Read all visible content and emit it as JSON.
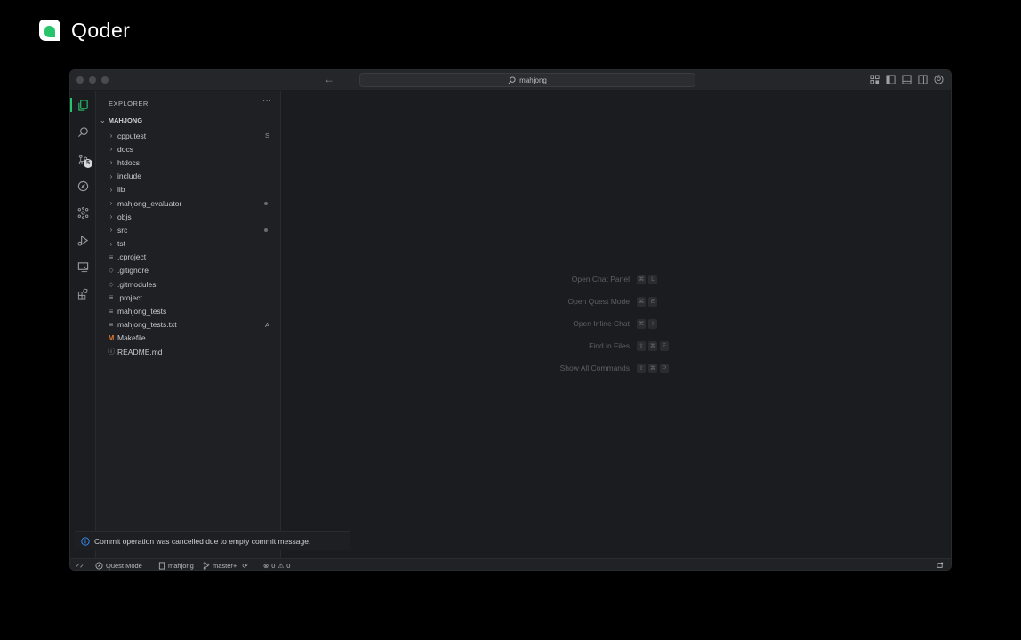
{
  "brand": {
    "name": "Qoder",
    "accent": "#27c46b"
  },
  "titlebar": {
    "search_text": "mahjong"
  },
  "activity_bar": {
    "items": [
      {
        "name": "explorer",
        "icon": "files-icon",
        "active": true
      },
      {
        "name": "search",
        "icon": "search-icon"
      },
      {
        "name": "source-control",
        "icon": "source-control-icon",
        "badge": "5"
      },
      {
        "name": "quest",
        "icon": "compass-icon"
      },
      {
        "name": "graph",
        "icon": "graph-icon"
      },
      {
        "name": "run-debug",
        "icon": "run-debug-icon"
      },
      {
        "name": "remote",
        "icon": "remote-explorer-icon"
      },
      {
        "name": "extensions",
        "icon": "extensions-icon"
      }
    ]
  },
  "sidebar": {
    "title": "EXPLORER",
    "more": "···",
    "root": "MAHJONG",
    "items": [
      {
        "label": "cpputest",
        "type": "folder",
        "status": "S"
      },
      {
        "label": "docs",
        "type": "folder"
      },
      {
        "label": "htdocs",
        "type": "folder"
      },
      {
        "label": "include",
        "type": "folder"
      },
      {
        "label": "lib",
        "type": "folder"
      },
      {
        "label": "mahjong_evaluator",
        "type": "folder",
        "dot": true
      },
      {
        "label": "objs",
        "type": "folder"
      },
      {
        "label": "src",
        "type": "folder",
        "dot": true
      },
      {
        "label": "tst",
        "type": "folder"
      },
      {
        "label": ".cproject",
        "type": "file",
        "icon": "lines-icon"
      },
      {
        "label": ".gitignore",
        "type": "file",
        "icon": "diamond-icon"
      },
      {
        "label": ".gitmodules",
        "type": "file",
        "icon": "diamond-icon"
      },
      {
        "label": ".project",
        "type": "file",
        "icon": "lines-icon"
      },
      {
        "label": "mahjong_tests",
        "type": "file",
        "icon": "lines-icon"
      },
      {
        "label": "mahjong_tests.txt",
        "type": "file",
        "icon": "lines-icon",
        "status": "A"
      },
      {
        "label": "Makefile",
        "type": "file",
        "icon": "makefile-icon"
      },
      {
        "label": "README.md",
        "type": "file",
        "icon": "info-icon"
      }
    ]
  },
  "editor": {
    "hints": [
      {
        "label": "Open Chat Panel",
        "keys": [
          "⌘",
          "L"
        ]
      },
      {
        "label": "Open Quest Mode",
        "keys": [
          "⌘",
          "E"
        ]
      },
      {
        "label": "Open Inline Chat",
        "keys": [
          "⌘",
          "I"
        ]
      },
      {
        "label": "Find in Files",
        "keys": [
          "⇧",
          "⌘",
          "F"
        ]
      },
      {
        "label": "Show All Commands",
        "keys": [
          "⇧",
          "⌘",
          "P"
        ]
      }
    ]
  },
  "notification": {
    "message": "Commit operation was cancelled due to empty commit message."
  },
  "statusbar": {
    "quest_mode": "Quest Mode",
    "repo": "mahjong",
    "branch": "master+",
    "errors": "0",
    "warnings": "0"
  }
}
